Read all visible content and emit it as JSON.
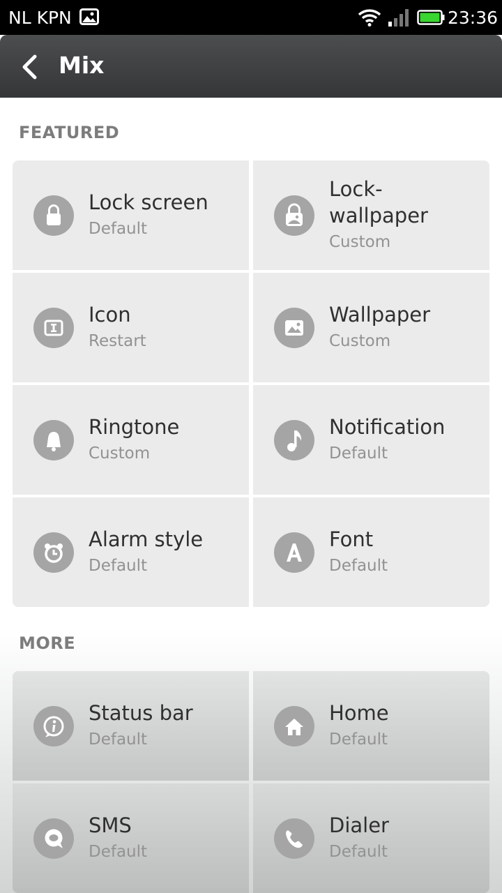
{
  "status_bar": {
    "carrier": "NL KPN",
    "time": "23:36",
    "battery_color": "#39d531"
  },
  "header": {
    "title": "Mix"
  },
  "featured": {
    "label": "FEATURED",
    "items": [
      {
        "title": "Lock screen",
        "subtitle": "Default",
        "icon": "lock-icon"
      },
      {
        "title": "Lock-\nwallpaper",
        "subtitle": "Custom",
        "icon": "lock-wallpaper-icon"
      },
      {
        "title": "Icon",
        "subtitle": "Restart",
        "icon": "icon-theme-icon"
      },
      {
        "title": "Wallpaper",
        "subtitle": "Custom",
        "icon": "wallpaper-icon"
      },
      {
        "title": "Ringtone",
        "subtitle": "Custom",
        "icon": "bell-icon"
      },
      {
        "title": "Notification",
        "subtitle": "Default",
        "icon": "music-note-icon"
      },
      {
        "title": "Alarm style",
        "subtitle": "Default",
        "icon": "alarm-clock-icon"
      },
      {
        "title": "Font",
        "subtitle": "Default",
        "icon": "font-icon"
      }
    ]
  },
  "more": {
    "label": "MORE",
    "items": [
      {
        "title": "Status bar",
        "subtitle": "Default",
        "icon": "info-icon"
      },
      {
        "title": "Home",
        "subtitle": "Default",
        "icon": "home-icon"
      },
      {
        "title": "SMS",
        "subtitle": "Default",
        "icon": "chat-bubble-icon"
      },
      {
        "title": "Dialer",
        "subtitle": "Default",
        "icon": "phone-icon"
      }
    ]
  }
}
